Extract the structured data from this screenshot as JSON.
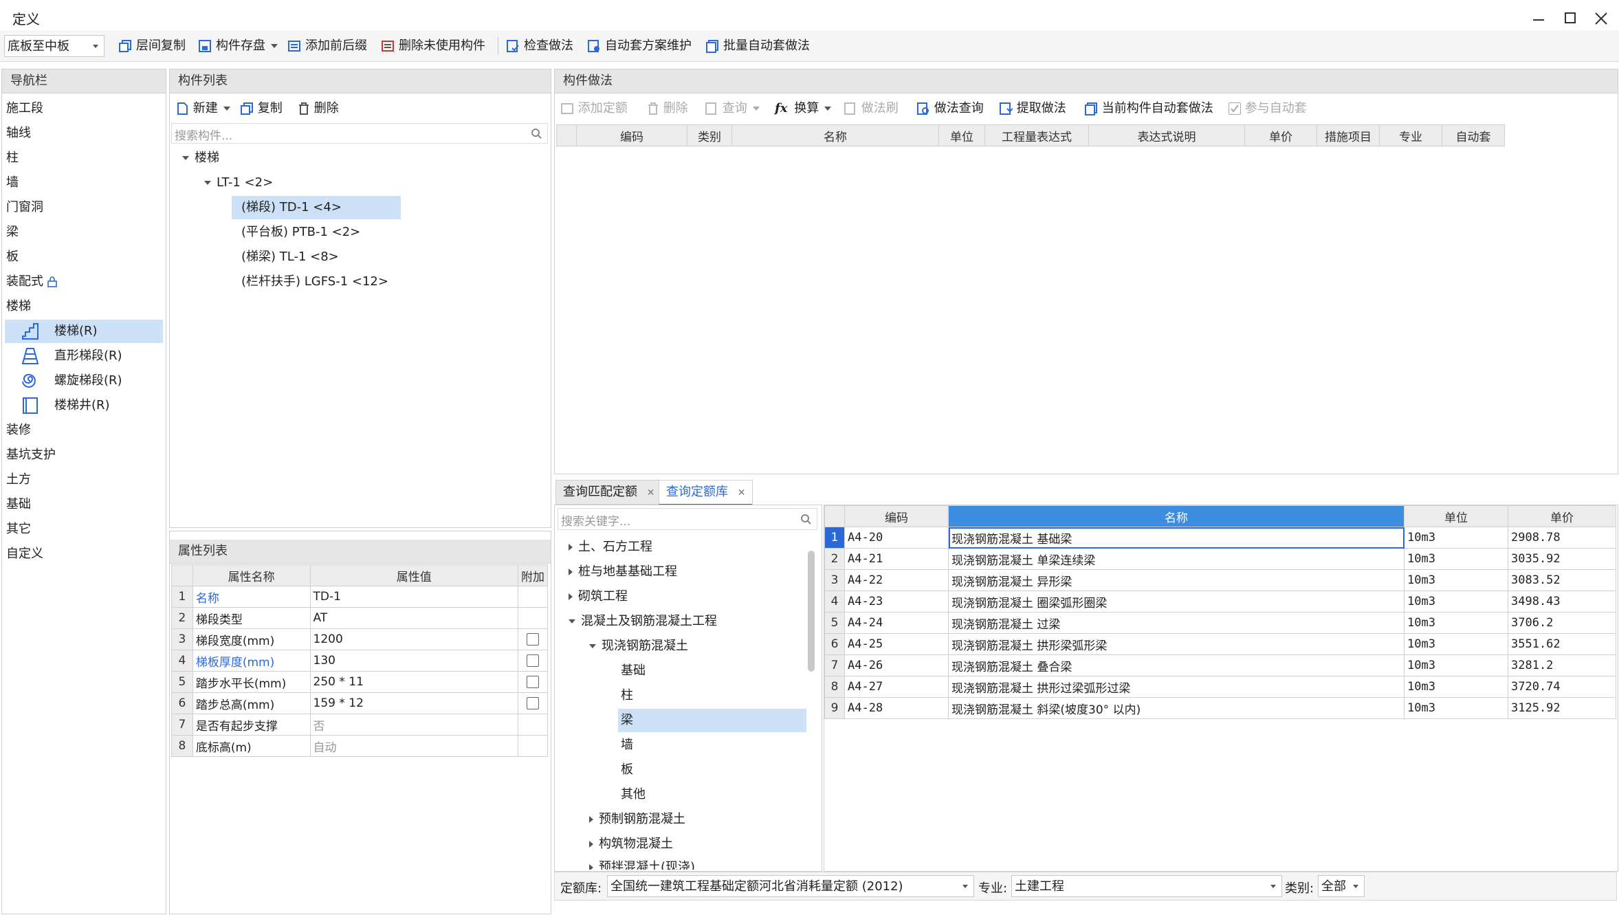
{
  "window": {
    "title": "定义"
  },
  "toolbar": {
    "floor_select": "底板至中板",
    "buttons": [
      {
        "label": "层间复制",
        "icon": "copy-icon"
      },
      {
        "label": "构件存盘",
        "icon": "save-icon"
      },
      {
        "label": "添加前后缀",
        "icon": "prefix-icon"
      },
      {
        "label": "删除未使用构件",
        "icon": "delete-unused-icon"
      },
      {
        "label": "检查做法",
        "icon": "check-icon"
      },
      {
        "label": "自动套方案维护",
        "icon": "scheme-icon"
      },
      {
        "label": "批量自动套做法",
        "icon": "batch-icon"
      }
    ]
  },
  "nav": {
    "title": "导航栏",
    "items": [
      "施工段",
      "轴线",
      "柱",
      "墙",
      "门窗洞",
      "梁",
      "板",
      "装配式",
      "楼梯"
    ],
    "sub_items": [
      "楼梯(R)",
      "直形梯段(R)",
      "螺旋梯段(R)",
      "楼梯井(R)"
    ],
    "items_after": [
      "装修",
      "基坑支护",
      "土方",
      "基础",
      "其它",
      "自定义"
    ]
  },
  "component_list": {
    "title": "构件列表",
    "new_label": "新建",
    "copy_label": "复制",
    "delete_label": "删除",
    "search_placeholder": "搜索构件...",
    "tree": {
      "root": "楼梯",
      "group": "LT-1 <2>",
      "children": [
        "(梯段) TD-1 <4>",
        "(平台板) PTB-1 <2>",
        "(梯梁) TL-1 <8>",
        "(栏杆扶手) LGFS-1 <12>"
      ]
    }
  },
  "properties": {
    "title": "属性列表",
    "headers": [
      "属性名称",
      "属性值",
      "附加"
    ],
    "rows": [
      {
        "n": "1",
        "name": "名称",
        "value": "TD-1"
      },
      {
        "n": "2",
        "name": "梯段类型",
        "value": "AT"
      },
      {
        "n": "3",
        "name": "梯段宽度(mm)",
        "value": "1200"
      },
      {
        "n": "4",
        "name": "梯板厚度(mm)",
        "value": "130"
      },
      {
        "n": "5",
        "name": "踏步水平长(mm)",
        "value": "250 * 11"
      },
      {
        "n": "6",
        "name": "踏步总高(mm)",
        "value": "159 * 12"
      },
      {
        "n": "7",
        "name": "是否有起步支撑",
        "value": "否"
      },
      {
        "n": "8",
        "name": "底标高(m)",
        "value": "自动"
      }
    ]
  },
  "method": {
    "title": "构件做法",
    "toolbar": [
      "添加定额",
      "删除",
      "查询",
      "换算",
      "做法刷",
      "做法查询",
      "提取做法",
      "当前构件自动套做法",
      "参与自动套"
    ],
    "headers": [
      "编码",
      "类别",
      "名称",
      "单位",
      "工程量表达式",
      "表达式说明",
      "单价",
      "措施项目",
      "专业",
      "自动套"
    ]
  },
  "query": {
    "tabs": [
      "查询匹配定额",
      "查询定额库"
    ],
    "search_placeholder": "搜索关键字...",
    "tree": {
      "top": [
        "土、石方工程",
        "桩与地基基础工程",
        "砌筑工程",
        "混凝土及钢筋混凝土工程"
      ],
      "sub": "现浇钢筋混凝土",
      "leaves": [
        "基础",
        "柱",
        "梁",
        "墙",
        "板",
        "其他"
      ],
      "more": [
        "预制钢筋混凝土",
        "构筑物混凝土",
        "预拌混凝土(现浇)"
      ]
    },
    "headers": [
      "编码",
      "名称",
      "单位",
      "单价"
    ],
    "rows": [
      {
        "n": "1",
        "code": "A4-20",
        "name": "现浇钢筋混凝土 基础梁",
        "unit": "10m3",
        "price": "2908.78"
      },
      {
        "n": "2",
        "code": "A4-21",
        "name": "现浇钢筋混凝土 单梁连续梁",
        "unit": "10m3",
        "price": "3035.92"
      },
      {
        "n": "3",
        "code": "A4-22",
        "name": "现浇钢筋混凝土 异形梁",
        "unit": "10m3",
        "price": "3083.52"
      },
      {
        "n": "4",
        "code": "A4-23",
        "name": "现浇钢筋混凝土 圈梁弧形圈梁",
        "unit": "10m3",
        "price": "3498.43"
      },
      {
        "n": "5",
        "code": "A4-24",
        "name": "现浇钢筋混凝土 过梁",
        "unit": "10m3",
        "price": "3706.2"
      },
      {
        "n": "6",
        "code": "A4-25",
        "name": "现浇钢筋混凝土 拱形梁弧形梁",
        "unit": "10m3",
        "price": "3551.62"
      },
      {
        "n": "7",
        "code": "A4-26",
        "name": "现浇钢筋混凝土 叠合梁",
        "unit": "10m3",
        "price": "3281.2"
      },
      {
        "n": "8",
        "code": "A4-27",
        "name": "现浇钢筋混凝土 拱形过梁弧形过梁",
        "unit": "10m3",
        "price": "3720.74"
      },
      {
        "n": "9",
        "code": "A4-28",
        "name": "现浇钢筋混凝土 斜梁(坡度30° 以内)",
        "unit": "10m3",
        "price": "3125.92"
      }
    ],
    "footer": {
      "lib_label": "定额库:",
      "lib_value": "全国统一建筑工程基础定额河北省消耗量定额 (2012)",
      "spec_label": "专业:",
      "spec_value": "土建工程",
      "cat_label": "类别:",
      "cat_value": "全部"
    }
  },
  "colors": {
    "accent": "#2a6ad8",
    "selection": "#cce0f8",
    "header_gray": "#e6e6e6"
  }
}
